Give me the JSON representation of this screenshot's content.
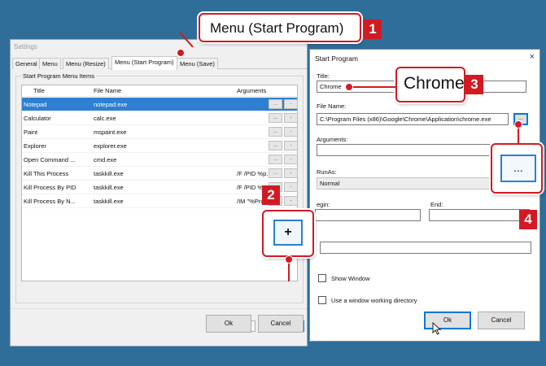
{
  "settings_window": {
    "title": "Settings",
    "tabs": [
      "General",
      "Menu",
      "Menu (Resize)",
      "Menu (Start Program)",
      "Menu (Save)"
    ],
    "active_tab": "Menu (Start Program)",
    "group_label": "Start Program Menu Items",
    "columns": [
      "Title",
      "File Name",
      "Arguments"
    ],
    "rows": [
      {
        "title": "Notepad",
        "file": "notepad.exe",
        "args": ""
      },
      {
        "title": "Calculator",
        "file": "calc.exe",
        "args": ""
      },
      {
        "title": "Paint",
        "file": "mspaint.exe",
        "args": ""
      },
      {
        "title": "Explorer",
        "file": "explorer.exe",
        "args": ""
      },
      {
        "title": "Open Command ...",
        "file": "cmd.exe",
        "args": ""
      },
      {
        "title": "Kill This Process",
        "file": "taskkill.exe",
        "args": "/F /PID %p..."
      },
      {
        "title": "Kill Process By PID",
        "file": "taskkill.exe",
        "args": "/F /PID %P..."
      },
      {
        "title": "Kill Process By N...",
        "file": "taskkill.exe",
        "args": "/IM \"%Proc..."
      }
    ],
    "row_edit_label": "...",
    "row_remove_label": "-",
    "move_up_label": "↑",
    "move_down_label": "↓",
    "add_label": "+",
    "ok_label": "Ok",
    "cancel_label": "Cancel"
  },
  "start_program_dialog": {
    "title": "Start Program",
    "close_label": "×",
    "title_label": "Title:",
    "title_value": "Chrome",
    "file_name_label": "File Name:",
    "file_name_value": "C:\\Program Files (x86)\\Google\\Chrome\\Application\\chrome.exe",
    "browse_label": "...",
    "arguments_label": "Arguments:",
    "arguments_value": "",
    "runas_label": "RunAs:",
    "runas_value": "Normal",
    "begin_label": "Begin:",
    "begin_visible": "egin:",
    "end_label": "End:",
    "show_window_label": "Show Window",
    "working_dir_label": "Use a window working directory",
    "ok_label": "Ok",
    "cancel_label": "Cancel"
  },
  "callouts": {
    "c1": {
      "text": "Menu (Start Program)",
      "number": "1"
    },
    "c2": {
      "text": "+",
      "number": "2"
    },
    "c3": {
      "text": "Chrome",
      "number": "3"
    },
    "c4": {
      "text": "...",
      "number": "4"
    }
  },
  "colors": {
    "accent": "#d21a23",
    "selection": "#2f7fd1",
    "background": "#2f6e98"
  }
}
